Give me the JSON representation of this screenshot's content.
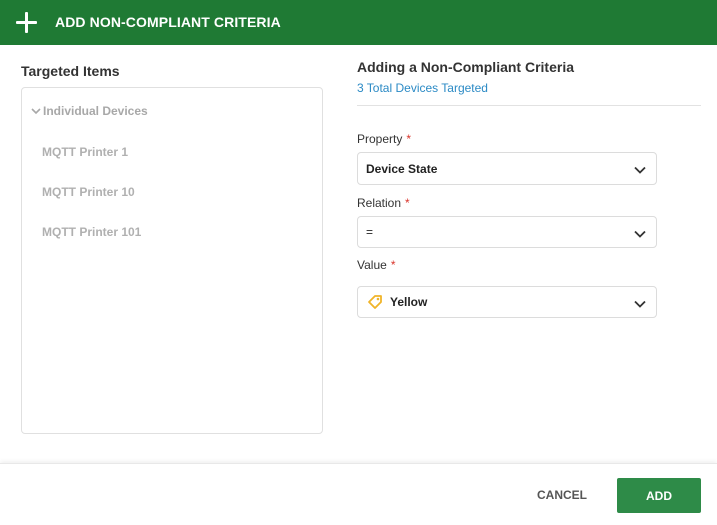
{
  "header": {
    "title": "ADD NON-COMPLIANT CRITERIA",
    "background": "#1f7a34"
  },
  "targeted": {
    "title": "Targeted Items",
    "group_label": "Individual Devices",
    "items": [
      "MQTT Printer 1",
      "MQTT Printer 10",
      "MQTT Printer 101"
    ]
  },
  "form": {
    "title": "Adding a Non-Compliant Criteria",
    "subtitle": "3 Total Devices Targeted",
    "property": {
      "label": "Property",
      "required": "*",
      "value": "Device State"
    },
    "relation": {
      "label": "Relation",
      "required": "*",
      "value": "="
    },
    "value": {
      "label": "Value",
      "required": "*",
      "value": "Yellow",
      "icon": "tag-icon",
      "icon_color": "#f0b429"
    }
  },
  "footer": {
    "cancel_label": "CANCEL",
    "add_label": "ADD",
    "add_color": "#2e8b48"
  }
}
